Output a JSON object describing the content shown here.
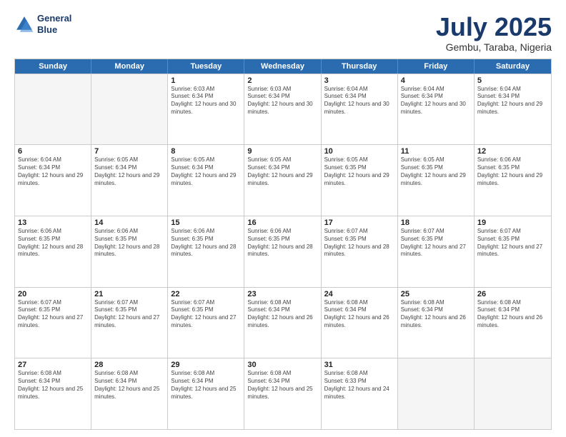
{
  "header": {
    "logo_line1": "General",
    "logo_line2": "Blue",
    "title": "July 2025",
    "subtitle": "Gembu, Taraba, Nigeria"
  },
  "days_of_week": [
    "Sunday",
    "Monday",
    "Tuesday",
    "Wednesday",
    "Thursday",
    "Friday",
    "Saturday"
  ],
  "weeks": [
    [
      {
        "day": "",
        "empty": true
      },
      {
        "day": "",
        "empty": true
      },
      {
        "day": "1",
        "sunrise": "6:03 AM",
        "sunset": "6:34 PM",
        "daylight": "12 hours and 30 minutes."
      },
      {
        "day": "2",
        "sunrise": "6:03 AM",
        "sunset": "6:34 PM",
        "daylight": "12 hours and 30 minutes."
      },
      {
        "day": "3",
        "sunrise": "6:04 AM",
        "sunset": "6:34 PM",
        "daylight": "12 hours and 30 minutes."
      },
      {
        "day": "4",
        "sunrise": "6:04 AM",
        "sunset": "6:34 PM",
        "daylight": "12 hours and 30 minutes."
      },
      {
        "day": "5",
        "sunrise": "6:04 AM",
        "sunset": "6:34 PM",
        "daylight": "12 hours and 29 minutes."
      }
    ],
    [
      {
        "day": "6",
        "sunrise": "6:04 AM",
        "sunset": "6:34 PM",
        "daylight": "12 hours and 29 minutes."
      },
      {
        "day": "7",
        "sunrise": "6:05 AM",
        "sunset": "6:34 PM",
        "daylight": "12 hours and 29 minutes."
      },
      {
        "day": "8",
        "sunrise": "6:05 AM",
        "sunset": "6:34 PM",
        "daylight": "12 hours and 29 minutes."
      },
      {
        "day": "9",
        "sunrise": "6:05 AM",
        "sunset": "6:34 PM",
        "daylight": "12 hours and 29 minutes."
      },
      {
        "day": "10",
        "sunrise": "6:05 AM",
        "sunset": "6:35 PM",
        "daylight": "12 hours and 29 minutes."
      },
      {
        "day": "11",
        "sunrise": "6:05 AM",
        "sunset": "6:35 PM",
        "daylight": "12 hours and 29 minutes."
      },
      {
        "day": "12",
        "sunrise": "6:06 AM",
        "sunset": "6:35 PM",
        "daylight": "12 hours and 29 minutes."
      }
    ],
    [
      {
        "day": "13",
        "sunrise": "6:06 AM",
        "sunset": "6:35 PM",
        "daylight": "12 hours and 28 minutes."
      },
      {
        "day": "14",
        "sunrise": "6:06 AM",
        "sunset": "6:35 PM",
        "daylight": "12 hours and 28 minutes."
      },
      {
        "day": "15",
        "sunrise": "6:06 AM",
        "sunset": "6:35 PM",
        "daylight": "12 hours and 28 minutes."
      },
      {
        "day": "16",
        "sunrise": "6:06 AM",
        "sunset": "6:35 PM",
        "daylight": "12 hours and 28 minutes."
      },
      {
        "day": "17",
        "sunrise": "6:07 AM",
        "sunset": "6:35 PM",
        "daylight": "12 hours and 28 minutes."
      },
      {
        "day": "18",
        "sunrise": "6:07 AM",
        "sunset": "6:35 PM",
        "daylight": "12 hours and 27 minutes."
      },
      {
        "day": "19",
        "sunrise": "6:07 AM",
        "sunset": "6:35 PM",
        "daylight": "12 hours and 27 minutes."
      }
    ],
    [
      {
        "day": "20",
        "sunrise": "6:07 AM",
        "sunset": "6:35 PM",
        "daylight": "12 hours and 27 minutes."
      },
      {
        "day": "21",
        "sunrise": "6:07 AM",
        "sunset": "6:35 PM",
        "daylight": "12 hours and 27 minutes."
      },
      {
        "day": "22",
        "sunrise": "6:07 AM",
        "sunset": "6:35 PM",
        "daylight": "12 hours and 27 minutes."
      },
      {
        "day": "23",
        "sunrise": "6:08 AM",
        "sunset": "6:34 PM",
        "daylight": "12 hours and 26 minutes."
      },
      {
        "day": "24",
        "sunrise": "6:08 AM",
        "sunset": "6:34 PM",
        "daylight": "12 hours and 26 minutes."
      },
      {
        "day": "25",
        "sunrise": "6:08 AM",
        "sunset": "6:34 PM",
        "daylight": "12 hours and 26 minutes."
      },
      {
        "day": "26",
        "sunrise": "6:08 AM",
        "sunset": "6:34 PM",
        "daylight": "12 hours and 26 minutes."
      }
    ],
    [
      {
        "day": "27",
        "sunrise": "6:08 AM",
        "sunset": "6:34 PM",
        "daylight": "12 hours and 25 minutes."
      },
      {
        "day": "28",
        "sunrise": "6:08 AM",
        "sunset": "6:34 PM",
        "daylight": "12 hours and 25 minutes."
      },
      {
        "day": "29",
        "sunrise": "6:08 AM",
        "sunset": "6:34 PM",
        "daylight": "12 hours and 25 minutes."
      },
      {
        "day": "30",
        "sunrise": "6:08 AM",
        "sunset": "6:34 PM",
        "daylight": "12 hours and 25 minutes."
      },
      {
        "day": "31",
        "sunrise": "6:08 AM",
        "sunset": "6:33 PM",
        "daylight": "12 hours and 24 minutes."
      },
      {
        "day": "",
        "empty": true
      },
      {
        "day": "",
        "empty": true
      }
    ]
  ]
}
